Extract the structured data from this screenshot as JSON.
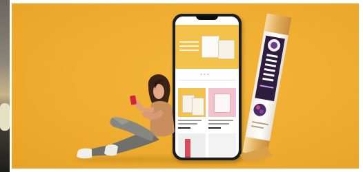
{
  "scene": {
    "background_color": "#efad30",
    "accent_colors": {
      "phone_frame": "#1c1c1e",
      "pack_gold": "#d9a04a",
      "pack_purple": "#3b2250",
      "tile_yellow": "#f3c24c",
      "tile_pink": "#f2c3cc"
    },
    "elements": [
      "woman-seated-with-phone",
      "oversized-smartphone",
      "oversized-stick-pack",
      "neighbor-slide-strip"
    ]
  }
}
